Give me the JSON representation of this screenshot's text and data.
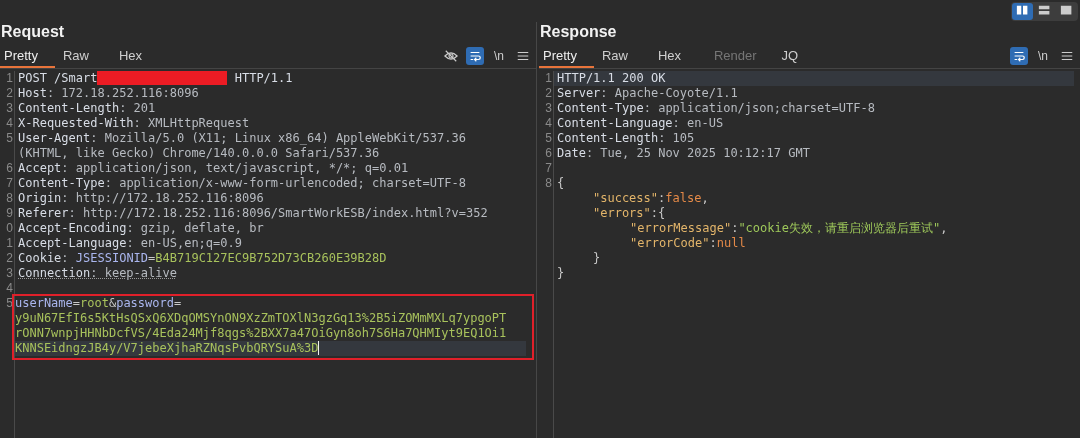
{
  "layout_toggle": [
    {
      "kind": "columns",
      "selected": true
    },
    {
      "kind": "rows",
      "selected": false
    },
    {
      "kind": "single",
      "selected": false
    }
  ],
  "request": {
    "title": "Request",
    "tabs": [
      {
        "label": "Pretty",
        "selected": true,
        "disabled": false
      },
      {
        "label": "Raw",
        "selected": false,
        "disabled": false
      },
      {
        "label": "Hex",
        "selected": false,
        "disabled": false
      }
    ],
    "toolbar": [
      {
        "kind": "eye-off",
        "on": false
      },
      {
        "kind": "wrap",
        "on": true
      },
      {
        "kind": "newline",
        "label": "\\n",
        "on": false
      },
      {
        "kind": "menu",
        "on": false
      }
    ],
    "lines": [
      {
        "kind": "row",
        "number": "1",
        "parts": [
          {
            "kind": "plain",
            "text": "POST /Smart"
          },
          {
            "kind": "redaction"
          },
          {
            "kind": "plain",
            "text": " HTTP/1.1"
          }
        ]
      },
      {
        "kind": "row",
        "number": "2",
        "parts": [
          {
            "kind": "key",
            "text": "Host"
          },
          {
            "kind": "value",
            "text": ": 172.18.252.116:8096"
          }
        ]
      },
      {
        "kind": "row",
        "number": "3",
        "parts": [
          {
            "kind": "key",
            "text": "Content-Length"
          },
          {
            "kind": "value",
            "text": ": 201"
          }
        ]
      },
      {
        "kind": "row",
        "number": "4",
        "parts": [
          {
            "kind": "key",
            "text": "X-Requested-With"
          },
          {
            "kind": "value",
            "text": ": XMLHttpRequest"
          }
        ]
      },
      {
        "kind": "row",
        "number": "5",
        "parts": [
          {
            "kind": "key",
            "text": "User-Agent"
          },
          {
            "kind": "value",
            "text": ": Mozilla/5.0 (X11; Linux x86_64) AppleWebKit/537.36"
          }
        ]
      },
      {
        "kind": "row",
        "parts": [
          {
            "kind": "value",
            "text": "(KHTML, like Gecko) Chrome/140.0.0.0 Safari/537.36"
          }
        ]
      },
      {
        "kind": "row",
        "number": "6",
        "parts": [
          {
            "kind": "key",
            "text": "Accept"
          },
          {
            "kind": "value",
            "text": ": application/json, text/javascript, */*; q=0.01"
          }
        ]
      },
      {
        "kind": "row",
        "number": "7",
        "parts": [
          {
            "kind": "key",
            "text": "Content-Type"
          },
          {
            "kind": "value",
            "text": ": application/x-www-form-urlencoded; charset=UTF-8"
          }
        ]
      },
      {
        "kind": "row",
        "number": "8",
        "parts": [
          {
            "kind": "key",
            "text": "Origin"
          },
          {
            "kind": "value",
            "text": ": http://172.18.252.116:8096"
          }
        ]
      },
      {
        "kind": "row",
        "number": "9",
        "parts": [
          {
            "kind": "key",
            "text": "Referer"
          },
          {
            "kind": "value",
            "text": ": http://172.18.252.116:8096/SmartWorkESB/index.html?v=352"
          }
        ]
      },
      {
        "kind": "row",
        "number": "0",
        "parts": [
          {
            "kind": "key",
            "text": "Accept-Encoding"
          },
          {
            "kind": "value",
            "text": ": gzip, deflate, br"
          }
        ]
      },
      {
        "kind": "row",
        "number": "1",
        "parts": [
          {
            "kind": "key",
            "text": "Accept-Language"
          },
          {
            "kind": "value",
            "text": ": en-US,en;q=0.9"
          }
        ]
      },
      {
        "kind": "row",
        "number": "2",
        "parts": [
          {
            "kind": "key",
            "text": "Cookie"
          },
          {
            "kind": "value",
            "text": ": "
          },
          {
            "kind": "param",
            "text": "JSESSIONID"
          },
          {
            "kind": "punct",
            "text": "="
          },
          {
            "kind": "param-value",
            "text": "B4B719C127EC9B752D73CB260E39B28D"
          }
        ]
      },
      {
        "kind": "row",
        "number": "3",
        "parts": [
          {
            "kind": "key-marked",
            "text": "Connection"
          },
          {
            "kind": "value-marked",
            "text": ": keep-alive"
          }
        ]
      },
      {
        "kind": "row",
        "number": "4"
      },
      {
        "kind": "outlined-block",
        "rows": [
          {
            "number": "5",
            "parts": [
              {
                "kind": "param",
                "text": "userName"
              },
              {
                "kind": "punct",
                "text": "="
              },
              {
                "kind": "param-value",
                "text": "root"
              },
              {
                "kind": "punct",
                "text": "&"
              },
              {
                "kind": "param",
                "text": "password"
              },
              {
                "kind": "punct",
                "text": "="
              }
            ]
          },
          {
            "parts": [
              {
                "kind": "param-value",
                "text": "y9uN67EfI6s5KtHsQSxQ6XDqOMSYnON9XzZmTOXlN3gzGq13%2B5iZOMmMXLq7ypgoPT"
              }
            ]
          },
          {
            "parts": [
              {
                "kind": "param-value",
                "text": "rONN7wnpjHHNbDcfVS/4Eda24Mjf8qgs%2BXX7a47OiGyn8oh7S6Ha7QHMIyt9EQ1Oi1"
              }
            ]
          },
          {
            "current": true,
            "caret": true,
            "parts": [
              {
                "kind": "param-value",
                "text": "KNNSEidngzJB4y/V7jebeXjhaRZNqsPvbQRYSuA%3D"
              }
            ]
          }
        ]
      }
    ]
  },
  "response": {
    "title": "Response",
    "tabs": [
      {
        "label": "Pretty",
        "selected": true,
        "disabled": false
      },
      {
        "label": "Raw",
        "selected": false,
        "disabled": false
      },
      {
        "label": "Hex",
        "selected": false,
        "disabled": false
      },
      {
        "label": "Render",
        "selected": false,
        "disabled": true
      },
      {
        "label": "JQ",
        "selected": false,
        "disabled": false
      }
    ],
    "toolbar": [
      {
        "kind": "wrap",
        "on": true
      },
      {
        "kind": "newline",
        "label": "\\n",
        "on": false
      },
      {
        "kind": "menu",
        "on": false
      }
    ],
    "lines": [
      {
        "kind": "row",
        "number": "1",
        "current": true,
        "parts": [
          {
            "kind": "plain",
            "text": "HTTP/1.1 200 OK"
          }
        ]
      },
      {
        "kind": "row",
        "number": "2",
        "parts": [
          {
            "kind": "key",
            "text": "Server"
          },
          {
            "kind": "value",
            "text": ": Apache-Coyote/1.1"
          }
        ]
      },
      {
        "kind": "row",
        "number": "3",
        "parts": [
          {
            "kind": "key",
            "text": "Content-Type"
          },
          {
            "kind": "value",
            "text": ": application/json;charset=UTF-8"
          }
        ]
      },
      {
        "kind": "row",
        "number": "4",
        "parts": [
          {
            "kind": "key",
            "text": "Content-Language"
          },
          {
            "kind": "value",
            "text": ": en-US"
          }
        ]
      },
      {
        "kind": "row",
        "number": "5",
        "parts": [
          {
            "kind": "key",
            "text": "Content-Length"
          },
          {
            "kind": "value",
            "text": ": 105"
          }
        ]
      },
      {
        "kind": "row",
        "number": "6",
        "parts": [
          {
            "kind": "key",
            "text": "Date"
          },
          {
            "kind": "value",
            "text": ": Tue, 25 Nov 2025 10:12:17 GMT"
          }
        ]
      },
      {
        "kind": "row",
        "number": "7"
      },
      {
        "kind": "row",
        "number": "8",
        "parts": [
          {
            "kind": "punct",
            "text": "{"
          }
        ]
      },
      {
        "kind": "nested",
        "parts": [
          {
            "kind": "json-key",
            "text": "\"success\""
          },
          {
            "kind": "punct",
            "text": ":"
          },
          {
            "kind": "json-literal",
            "text": "false"
          },
          {
            "kind": "punct",
            "text": ","
          }
        ]
      },
      {
        "kind": "nested",
        "parts": [
          {
            "kind": "json-key",
            "text": "\"errors\""
          },
          {
            "kind": "punct",
            "text": ":{"
          }
        ]
      },
      {
        "kind": "subnested",
        "parts": [
          {
            "kind": "json-key",
            "text": "\"errorMessage\""
          },
          {
            "kind": "punct",
            "text": ":"
          },
          {
            "kind": "json-string",
            "text": "\"cookie失效，请重启浏览器后重试\""
          },
          {
            "kind": "punct",
            "text": ","
          }
        ]
      },
      {
        "kind": "subnested",
        "parts": [
          {
            "kind": "json-key",
            "text": "\"errorCode\""
          },
          {
            "kind": "punct",
            "text": ":"
          },
          {
            "kind": "json-literal",
            "text": "null"
          }
        ]
      },
      {
        "kind": "nested",
        "parts": [
          {
            "kind": "punct",
            "text": "}"
          }
        ]
      },
      {
        "kind": "row",
        "parts": [
          {
            "kind": "punct",
            "text": "}"
          }
        ]
      }
    ]
  }
}
